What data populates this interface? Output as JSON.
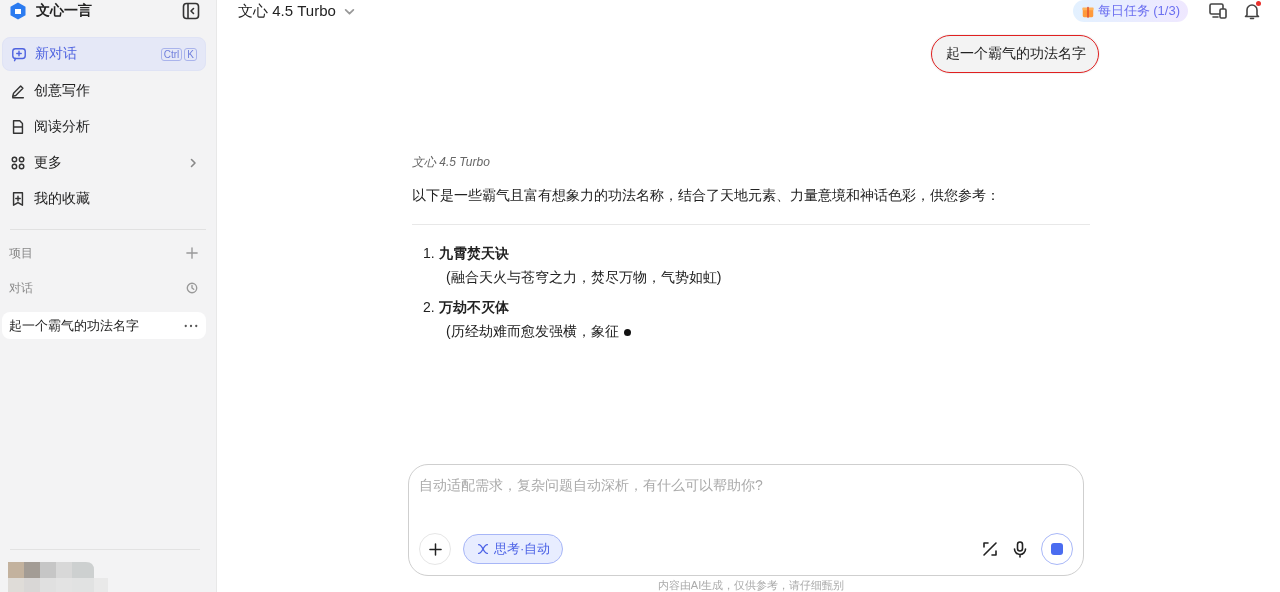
{
  "sidebar": {
    "brand": "文心一言",
    "nav_items": [
      {
        "kind": "new",
        "label": "新对话",
        "selected": true,
        "shortcut": [
          "Ctrl",
          "K"
        ]
      },
      {
        "kind": "write",
        "label": "创意写作",
        "selected": false
      },
      {
        "kind": "read",
        "label": "阅读分析",
        "selected": false
      },
      {
        "kind": "more",
        "label": "更多",
        "selected": false
      },
      {
        "kind": "favorite",
        "label": "我的收藏",
        "selected": false
      }
    ],
    "projects_label": "项目",
    "conversations_label": "对话",
    "conversations": [
      {
        "title": "起一个霸气的功法名字",
        "selected": true
      }
    ]
  },
  "header": {
    "model": "文心 4.5 Turbo",
    "task_badge": "每日任务 (1/3)",
    "notification_dot": true
  },
  "chat": {
    "user_message": {
      "text": "起一个霸气的功法名字",
      "highlighted": true
    },
    "reply": {
      "model": "文心 4.5 Turbo",
      "intro": "以下是一些霸气且富有想象力的功法名称，结合了天地元素、力量意境和神话色彩，供您参考：",
      "items": [
        {
          "number": "1.",
          "title": "九霄焚天诀",
          "note": "(融合天火与苍穹之力，焚尽万物，气势如虹)"
        },
        {
          "number": "2.",
          "title": "万劫不灭体",
          "note": "(历经劫难而愈发强横，象征"
        }
      ],
      "generating": true
    }
  },
  "composer": {
    "placeholder": "自动适配需求，复杂问题自动深析，有什么可以帮助你?",
    "mode": "思考·自动",
    "disclaimer": "内容由AI生成，仅供参考，请仔细甄别"
  }
}
